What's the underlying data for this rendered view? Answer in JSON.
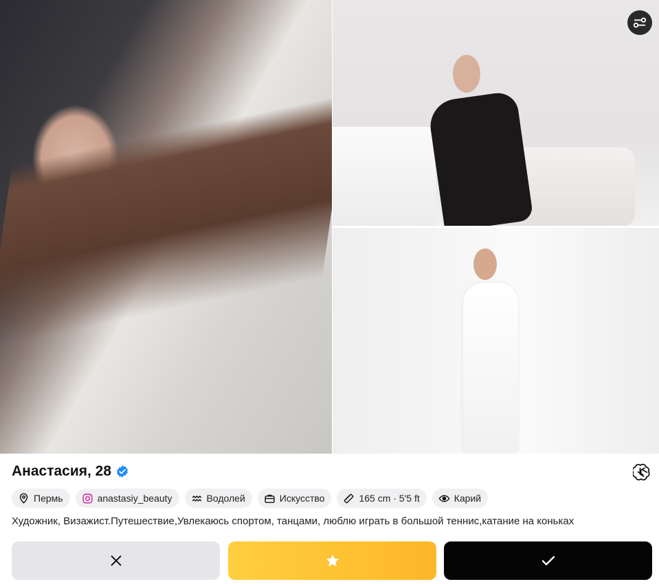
{
  "profile": {
    "name_age": "Анастасия, 28",
    "verified": true,
    "bio": "Художник, Визажист.Путешествие,Увлекаюсь спортом, танцами, люблю играть в большой теннис,катание на коньках"
  },
  "chips": [
    {
      "icon": "location-pin-icon",
      "label": "Пермь"
    },
    {
      "icon": "instagram-icon",
      "label": "anastasiy_beauty"
    },
    {
      "icon": "zodiac-aquarius-icon",
      "label": "Водолей"
    },
    {
      "icon": "briefcase-icon",
      "label": "Искусство"
    },
    {
      "icon": "ruler-icon",
      "label": "165 cm · 5'5 ft"
    },
    {
      "icon": "eye-icon",
      "label": "Карий"
    }
  ],
  "actions": {
    "dislike_icon": "close-icon",
    "superlike_icon": "star-icon",
    "like_icon": "check-icon"
  },
  "colors": {
    "verified_blue": "#1d8cf8",
    "superlike_gradient_start": "#ffcf3f",
    "superlike_gradient_end": "#fdb729",
    "like_bg": "#050505",
    "dislike_bg": "#e5e5ea"
  }
}
